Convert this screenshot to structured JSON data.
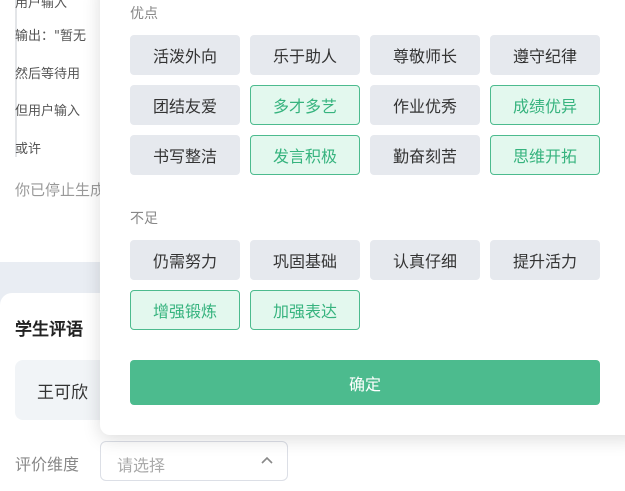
{
  "chat": {
    "lines": [
      "用户输入",
      "输出：\"暂无",
      "然后等待用",
      "但用户输入",
      "或许"
    ],
    "stopped": "你已停止生成"
  },
  "eval": {
    "title": "学生评语",
    "student_name": "王可欣",
    "dimension_label": "评价维度",
    "dimension_placeholder": "请选择"
  },
  "popup": {
    "strengths_title": "优点",
    "strengths": [
      {
        "label": "活泼外向",
        "selected": false
      },
      {
        "label": "乐于助人",
        "selected": false
      },
      {
        "label": "尊敬师长",
        "selected": false
      },
      {
        "label": "遵守纪律",
        "selected": false
      },
      {
        "label": "团结友爱",
        "selected": false
      },
      {
        "label": "多才多艺",
        "selected": true
      },
      {
        "label": "作业优秀",
        "selected": false
      },
      {
        "label": "成绩优异",
        "selected": true
      },
      {
        "label": "书写整洁",
        "selected": false
      },
      {
        "label": "发言积极",
        "selected": true
      },
      {
        "label": "勤奋刻苦",
        "selected": false
      },
      {
        "label": "思维开拓",
        "selected": true
      }
    ],
    "weaknesses_title": "不足",
    "weaknesses": [
      {
        "label": "仍需努力",
        "selected": false
      },
      {
        "label": "巩固基础",
        "selected": false
      },
      {
        "label": "认真仔细",
        "selected": false
      },
      {
        "label": "提升活力",
        "selected": false
      },
      {
        "label": "增强锻炼",
        "selected": true
      },
      {
        "label": "加强表达",
        "selected": true
      }
    ],
    "confirm_label": "确定"
  },
  "colors": {
    "accent": "#4cbb8e",
    "selected_bg": "#e3f8ee",
    "tag_bg": "#e6e9ee"
  }
}
